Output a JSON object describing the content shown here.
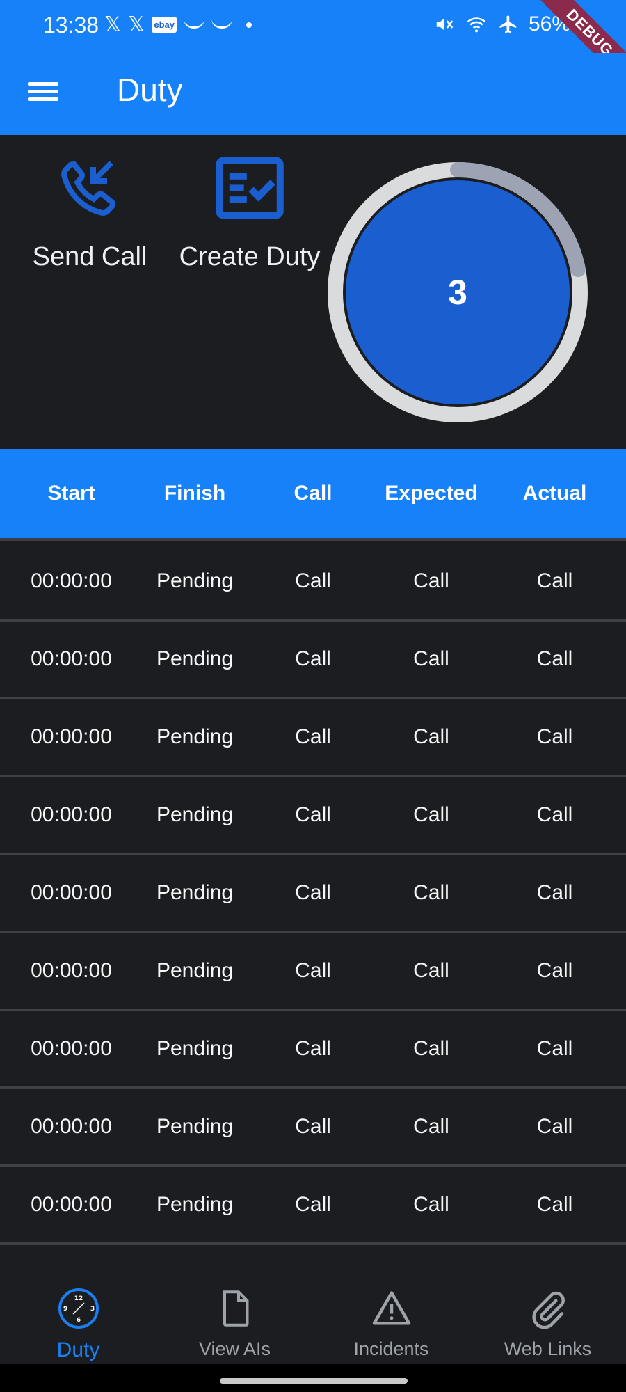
{
  "status_bar": {
    "time": "13:38",
    "left_icons": [
      "x-logo-icon",
      "x-logo-icon",
      "ebay-icon",
      "amazon-icon",
      "amazon-icon",
      "dot-icon"
    ],
    "ebay_text": "ebay",
    "battery": "56%",
    "right_icons": [
      "mute-icon",
      "wifi-icon",
      "airplane-icon",
      "battery-icon"
    ],
    "debug_ribbon": "DEBUG"
  },
  "app_bar": {
    "title": "Duty"
  },
  "actions": {
    "send_call": {
      "label": "Send Call",
      "icon": "incoming-call-icon"
    },
    "create_duty": {
      "label": "Create Duty",
      "icon": "checklist-icon"
    }
  },
  "counter": {
    "value": "3",
    "progress": 0.22
  },
  "table": {
    "headers": [
      "Start",
      "Finish",
      "Call",
      "Expected",
      "Actual"
    ],
    "rows": [
      [
        "00:00:00",
        "Pending",
        "Call",
        "Call",
        "Call"
      ],
      [
        "00:00:00",
        "Pending",
        "Call",
        "Call",
        "Call"
      ],
      [
        "00:00:00",
        "Pending",
        "Call",
        "Call",
        "Call"
      ],
      [
        "00:00:00",
        "Pending",
        "Call",
        "Call",
        "Call"
      ],
      [
        "00:00:00",
        "Pending",
        "Call",
        "Call",
        "Call"
      ],
      [
        "00:00:00",
        "Pending",
        "Call",
        "Call",
        "Call"
      ],
      [
        "00:00:00",
        "Pending",
        "Call",
        "Call",
        "Call"
      ],
      [
        "00:00:00",
        "Pending",
        "Call",
        "Call",
        "Call"
      ],
      [
        "00:00:00",
        "Pending",
        "Call",
        "Call",
        "Call"
      ]
    ]
  },
  "bottom_nav": [
    {
      "label": "Duty",
      "icon": "clock-icon",
      "active": true
    },
    {
      "label": "View AIs",
      "icon": "document-icon",
      "active": false
    },
    {
      "label": "Incidents",
      "icon": "warning-icon",
      "active": false
    },
    {
      "label": "Web Links",
      "icon": "paperclip-icon",
      "active": false
    }
  ],
  "colors": {
    "primary": "#1681f9",
    "background": "#1b1d20",
    "icon_blue": "#1a5ecf",
    "active_nav": "#1a7ff2"
  }
}
